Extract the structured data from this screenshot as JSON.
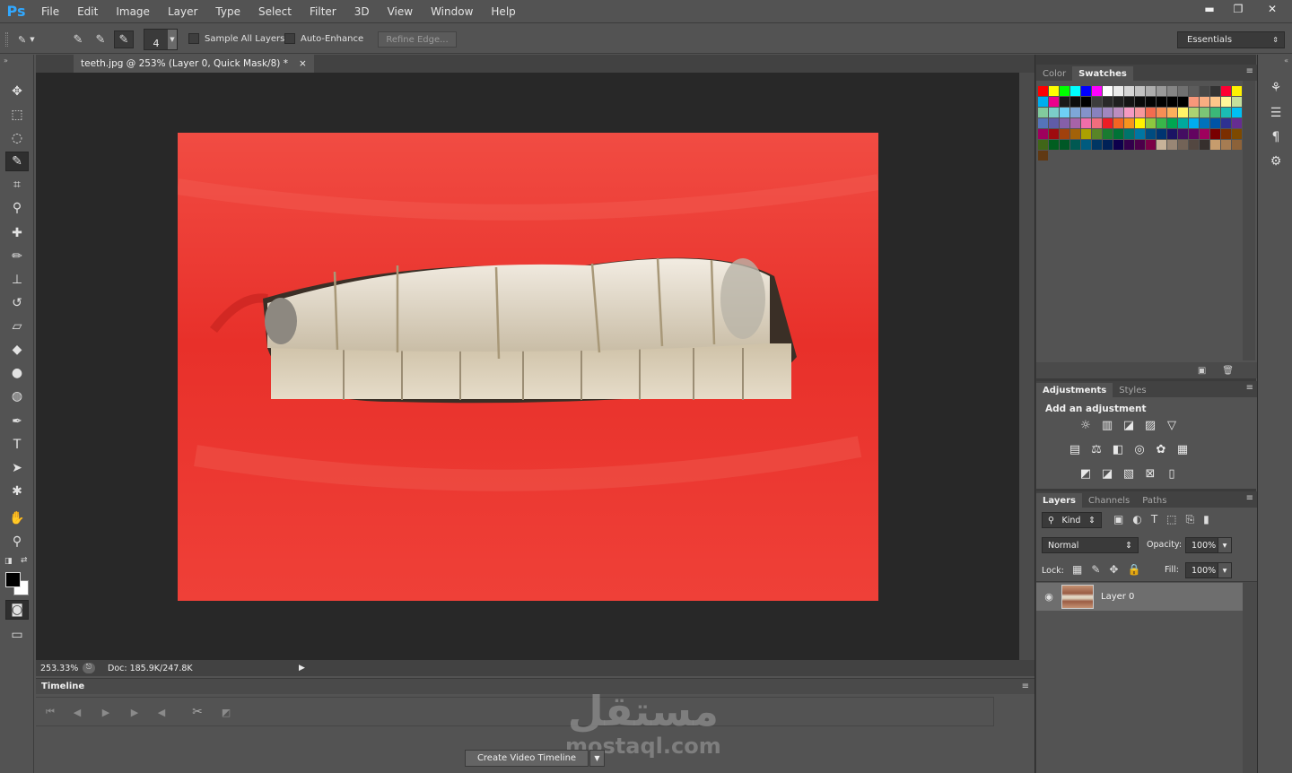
{
  "app": {
    "logo": "Ps"
  },
  "menu": [
    "File",
    "Edit",
    "Image",
    "Layer",
    "Type",
    "Select",
    "Filter",
    "3D",
    "View",
    "Window",
    "Help"
  ],
  "window_controls": {
    "minimize": "▬",
    "restore": "❐",
    "close": "✕"
  },
  "options_bar": {
    "brush_size": "4",
    "sample_all_layers": {
      "label": "Sample All Layers",
      "checked": false
    },
    "auto_enhance": {
      "label": "Auto-Enhance",
      "checked": false
    },
    "refine_edge": "Refine Edge...",
    "workspace": "Essentials"
  },
  "document": {
    "tab_title": "teeth.jpg @ 253% (Layer 0, Quick Mask/8) *",
    "tab_close": "×",
    "zoom": "253.33%",
    "doc_size": "Doc: 185.9K/247.8K"
  },
  "timeline": {
    "tab": "Timeline",
    "create_button": "Create Video Timeline"
  },
  "watermark": {
    "arabic": "مستقل",
    "latin": "mostaql.com"
  },
  "color_panel": {
    "tabs": [
      "Color",
      "Swatches"
    ],
    "active": "Swatches"
  },
  "swatches": [
    "#ff0000",
    "#ffff00",
    "#00ff00",
    "#00ffff",
    "#0000ff",
    "#ff00ff",
    "#ffffff",
    "#ebebeb",
    "#d6d6d6",
    "#c2c2c2",
    "#adadad",
    "#999999",
    "#858585",
    "#707070",
    "#5c5c5c",
    "#474747",
    "#333333",
    "#ff0033",
    "#fff200",
    "#00a651",
    "#00aeef",
    "#ec008c",
    "#1a1a1a",
    "#0d0d0d",
    "#000000",
    "#3d3d3d",
    "#292929",
    "#1f1f1f",
    "#141414",
    "#0a0a0a",
    "#050505",
    "#020202",
    "#000000",
    "#000000",
    "#f7977a",
    "#f9ad81",
    "#fdc68a",
    "#fff79a",
    "#c4df9b",
    "#a2d39c",
    "#82ca9d",
    "#7bcdc8",
    "#6ecff6",
    "#7ea7d8",
    "#8493ca",
    "#8882be",
    "#a187be",
    "#bc8dbf",
    "#f49ac2",
    "#f6989d",
    "#f26c4f",
    "#f68e55",
    "#fbaf5c",
    "#fff467",
    "#acd372",
    "#7cc576",
    "#3bb878",
    "#1abbb4",
    "#00bff3",
    "#438ccb",
    "#5574b9",
    "#605ca8",
    "#855fa8",
    "#a763a8",
    "#f06ea9",
    "#f26d7d",
    "#ed1c24",
    "#f26522",
    "#f7941d",
    "#fff200",
    "#8dc73f",
    "#39b54a",
    "#00a651",
    "#00a99d",
    "#00aeef",
    "#0072bc",
    "#0054a6",
    "#2e3192",
    "#662d91",
    "#92278f",
    "#9e005d",
    "#9e0b0f",
    "#a0410d",
    "#a36209",
    "#aba000",
    "#598527",
    "#197b30",
    "#007236",
    "#00746b",
    "#0076a3",
    "#004b80",
    "#003471",
    "#1b1464",
    "#440e62",
    "#630460",
    "#9e005d",
    "#790000",
    "#7b2e00",
    "#7d4900",
    "#827b00",
    "#406618",
    "#005e20",
    "#005826",
    "#005952",
    "#005b7f",
    "#003663",
    "#002157",
    "#0d004c",
    "#32004b",
    "#4b0049",
    "#7b0046",
    "#c7b299",
    "#998675",
    "#736357",
    "#534741",
    "#362f2d",
    "#c69c6d",
    "#a67c52",
    "#8c6239",
    "#754c24",
    "#603913"
  ],
  "adjustments_panel": {
    "tabs": [
      "Adjustments",
      "Styles"
    ],
    "title": "Add an adjustment",
    "row1": [
      "☼",
      "▥",
      "◪",
      "▨",
      "▽"
    ],
    "row2": [
      "▤",
      "⚖",
      "◧",
      "◎",
      "✿",
      "▦"
    ],
    "row3": [
      "◩",
      "◪",
      "▧",
      "⊠",
      "▯"
    ]
  },
  "layers_panel": {
    "tabs": [
      "Layers",
      "Channels",
      "Paths"
    ],
    "filter": "Kind",
    "blend_mode": "Normal",
    "opacity_label": "Opacity:",
    "opacity": "100%",
    "lock_label": "Lock:",
    "fill_label": "Fill:",
    "fill": "100%",
    "layers": [
      {
        "name": "Layer 0",
        "visible": true
      }
    ]
  }
}
